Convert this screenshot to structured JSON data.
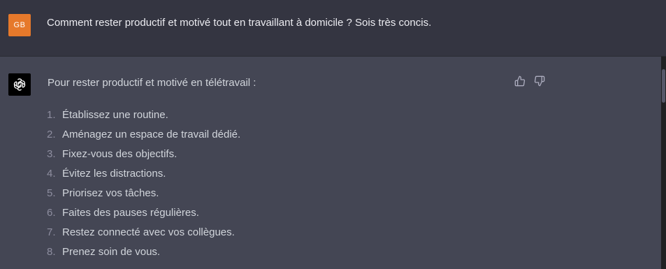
{
  "user_message": {
    "avatar_initials": "GB",
    "avatar_color": "#e6792b",
    "text": "Comment rester productif et motivé tout en travaillant à domicile ? Sois très concis."
  },
  "assistant_message": {
    "avatar_icon": "openai-logo-icon",
    "intro": "Pour rester productif et motivé en télétravail :",
    "items": [
      {
        "number": "1.",
        "text": "Établissez une routine."
      },
      {
        "number": "2.",
        "text": "Aménagez un espace de travail dédié."
      },
      {
        "number": "3.",
        "text": "Fixez-vous des objectifs."
      },
      {
        "number": "4.",
        "text": "Évitez les distractions."
      },
      {
        "number": "5.",
        "text": "Priorisez vos tâches."
      },
      {
        "number": "6.",
        "text": "Faites des pauses régulières."
      },
      {
        "number": "7.",
        "text": "Restez connecté avec vos collègues."
      },
      {
        "number": "8.",
        "text": "Prenez soin de vous."
      }
    ],
    "feedback_icons": [
      "thumbs-up-icon",
      "thumbs-down-icon"
    ]
  },
  "colors": {
    "user_bg": "#343541",
    "assistant_bg": "#444654",
    "text": "#d1d5db",
    "number": "#8e8ea0"
  }
}
